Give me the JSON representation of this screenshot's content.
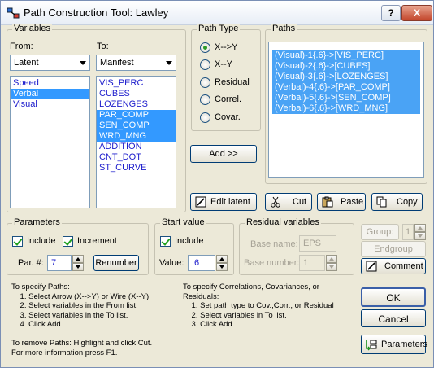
{
  "window": {
    "title": "Path Construction Tool: Lawley",
    "help_btn": "?",
    "close_btn": "X"
  },
  "variables": {
    "group_label": "Variables",
    "from_label": "From:",
    "to_label": "To:",
    "from_selected": "Latent",
    "to_selected": "Manifest",
    "from_items": [
      {
        "label": "Speed",
        "selected": false
      },
      {
        "label": "Verbal",
        "selected": true
      },
      {
        "label": "Visual",
        "selected": false
      }
    ],
    "to_items": [
      {
        "label": "VIS_PERC",
        "selected": false
      },
      {
        "label": "CUBES",
        "selected": false
      },
      {
        "label": "LOZENGES",
        "selected": false
      },
      {
        "label": "PAR_COMP",
        "selected": true
      },
      {
        "label": "SEN_COMP",
        "selected": true
      },
      {
        "label": "WRD_MNG",
        "selected": true
      },
      {
        "label": "ADDITION",
        "selected": false
      },
      {
        "label": "CNT_DOT",
        "selected": false
      },
      {
        "label": "ST_CURVE",
        "selected": false
      }
    ]
  },
  "path_type": {
    "group_label": "Path Type",
    "options": [
      {
        "label": "X-->Y",
        "checked": true
      },
      {
        "label": "X--Y",
        "checked": false
      },
      {
        "label": "Residual",
        "checked": false
      },
      {
        "label": "Correl.",
        "checked": false
      },
      {
        "label": "Covar.",
        "checked": false
      }
    ],
    "add_button": "Add >>"
  },
  "paths": {
    "group_label": "Paths",
    "items": [
      {
        "label": "(Visual)-1{.6}->[VIS_PERC]",
        "selected": true
      },
      {
        "label": "(Visual)-2{.6}->[CUBES]",
        "selected": true
      },
      {
        "label": "(Visual)-3{.6}->[LOZENGES]",
        "selected": true
      },
      {
        "label": "(Verbal)-4{.6}->[PAR_COMP]",
        "selected": true
      },
      {
        "label": "(Verbal)-5{.6}->[SEN_COMP]",
        "selected": true
      },
      {
        "label": "(Verbal)-6{.6}->[WRD_MNG]",
        "selected": true
      }
    ]
  },
  "actions": {
    "edit_latent": "Edit latent",
    "cut": "Cut",
    "paste": "Paste",
    "copy": "Copy"
  },
  "parameters": {
    "group_label": "Parameters",
    "include_label": "Include",
    "include_checked": true,
    "increment_label": "Increment",
    "increment_checked": true,
    "par_label": "Par. #:",
    "par_value": "7",
    "renumber": "Renumber"
  },
  "start_value": {
    "group_label": "Start value",
    "include_label": "Include",
    "include_checked": true,
    "value_label": "Value:",
    "value": ".6"
  },
  "residual": {
    "group_label": "Residual variables",
    "base_name_label": "Base name:",
    "base_name": "EPS",
    "base_number_label": "Base number:",
    "base_number": "1"
  },
  "group_ctrl": {
    "group_label": "Group:",
    "group_value": "1",
    "endgroup": "Endgroup",
    "comment": "Comment"
  },
  "buttons": {
    "ok": "OK",
    "cancel": "Cancel",
    "parameters": "Parameters"
  },
  "help": {
    "left": "To specify Paths:\n    1. Select Arrow (X-->Y) or Wire (X--Y).\n    2. Select variables in the From list.\n    3. Select variables in the To list.\n    4. Click Add.\n\nTo remove Paths: Highlight and click Cut.\nFor more information press F1.",
    "right": "To specify Correlations, Covariances, or\nResiduals:\n    1. Set path type to Cov.,Corr., or Residual\n    2. Select variables in To list.\n    3. Click Add."
  }
}
